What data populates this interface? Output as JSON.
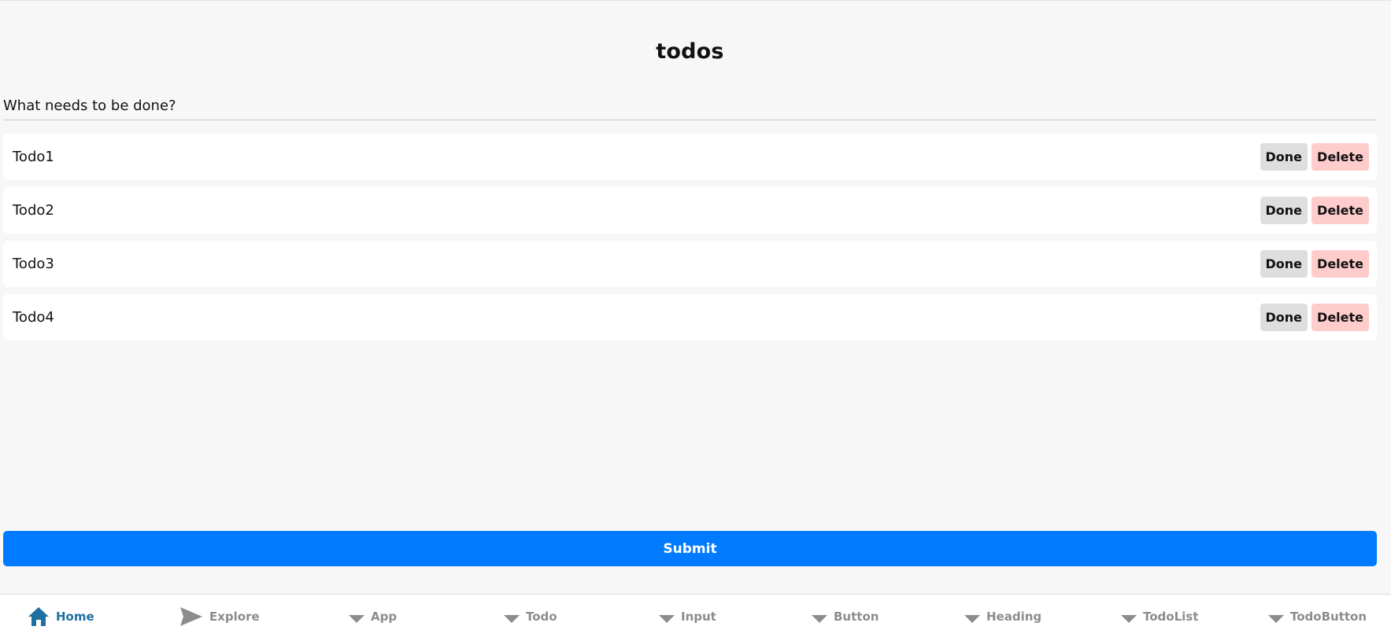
{
  "header": {
    "title": "todos"
  },
  "new_todo": {
    "placeholder": "What needs to be done?",
    "value": ""
  },
  "todos": [
    {
      "text": "Todo1",
      "done_label": "Done",
      "delete_label": "Delete"
    },
    {
      "text": "Todo2",
      "done_label": "Done",
      "delete_label": "Delete"
    },
    {
      "text": "Todo3",
      "done_label": "Done",
      "delete_label": "Delete"
    },
    {
      "text": "Todo4",
      "done_label": "Done",
      "delete_label": "Delete"
    }
  ],
  "submit": {
    "label": "Submit"
  },
  "colors": {
    "background": "#f7f7f7",
    "primary": "#007bff",
    "done_button": "#dedede",
    "delete_button": "#ffcccc",
    "tab_active": "#1f6fa0",
    "tab_inactive": "#8c8c8c"
  },
  "tabs": [
    {
      "label": "Home",
      "icon": "home-icon",
      "active": true
    },
    {
      "label": "Explore",
      "icon": "send-icon",
      "active": false
    },
    {
      "label": "App",
      "icon": "caret-down-icon",
      "active": false
    },
    {
      "label": "Todo",
      "icon": "caret-down-icon",
      "active": false
    },
    {
      "label": "Input",
      "icon": "caret-down-icon",
      "active": false
    },
    {
      "label": "Button",
      "icon": "caret-down-icon",
      "active": false
    },
    {
      "label": "Heading",
      "icon": "caret-down-icon",
      "active": false
    },
    {
      "label": "TodoList",
      "icon": "caret-down-icon",
      "active": false
    },
    {
      "label": "TodoButton",
      "icon": "caret-down-icon",
      "active": false
    }
  ]
}
